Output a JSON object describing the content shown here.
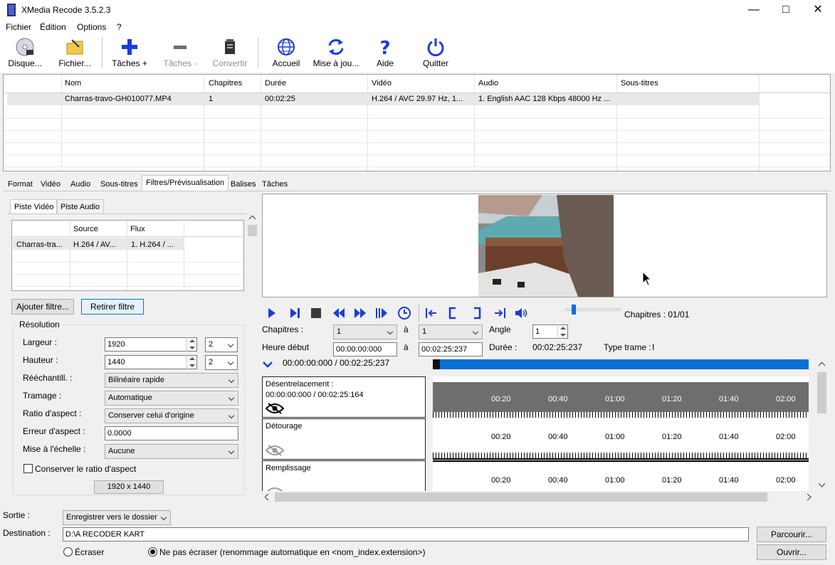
{
  "window": {
    "title": "XMedia Recode 3.5.2.3"
  },
  "menu": [
    "Fichier",
    "Édition",
    "Options",
    "?"
  ],
  "toolbar": {
    "disc": "Disque...",
    "file": "Fichier...",
    "add_task": "Tâches +",
    "remove_task": "Tâches -",
    "convert": "Convertir",
    "home": "Accueil",
    "update": "Mise à jou...",
    "help": "Aide",
    "quit": "Quitter"
  },
  "filelist": {
    "headers": [
      "Nom",
      "Chapitres",
      "Durée",
      "Vidéo",
      "Audio",
      "Sous-titres"
    ],
    "rows": [
      {
        "name": "Charras-travo-GH010077.MP4",
        "chapters": "1",
        "duration": "00:02:25",
        "video": "H.264 / AVC  29.97 Hz, 1...",
        "audio": "1. English AAC  128 Kbps 48000 Hz ...",
        "subtitles": ""
      }
    ]
  },
  "tabs": [
    "Format",
    "Vidéo",
    "Audio",
    "Sous-titres",
    "Filtres/Prévisualisation",
    "Balises",
    "Tâches"
  ],
  "left": {
    "subtabs": [
      "Piste Vidéo",
      "Piste Audio"
    ],
    "grid": {
      "headers": [
        "",
        "Source",
        "Flux"
      ],
      "row": [
        "Charras-tra...",
        "H.264 / AV...",
        "1. H.264 / ..."
      ]
    },
    "add_filter": "Ajouter filtre...",
    "remove_filter": "Retirer filtre",
    "resolution_group": "Résolution",
    "width_label": "Largeur :",
    "width_value": "1920",
    "width_mult": "2",
    "height_label": "Hauteur :",
    "height_value": "1440",
    "height_mult": "2",
    "resample_label": "Rééchantill. :",
    "resample_value": "Bilinéaire rapide",
    "dither_label": "Tramage :",
    "dither_value": "Automatique",
    "aspect_label": "Ratio d'aspect :",
    "aspect_value": "Conserver celui d'origine",
    "aspect_error_label": "Erreur d'aspect :",
    "aspect_error_value": "0.0000",
    "scale_label": "Mise à l'échelle :",
    "scale_value": "Aucune",
    "keep_ratio_label": "Conserver le ratio d'aspect",
    "resolution_display": "1920 x 1440"
  },
  "player": {
    "chapters_count": "Chapitres : 01/01",
    "chapters_label": "Chapitres :",
    "chapter_from": "1",
    "to_label": "à",
    "chapter_to": "1",
    "angle_label": "Angle",
    "angle_value": "1",
    "start_label": "Heure début",
    "start_value": "00:00:00:000",
    "end_value": "00:02:25:237",
    "duration_label": "Durée :",
    "duration_value": "00:02:25:237",
    "frame_type_label": "Type trame :",
    "frame_type_value": "I",
    "position": "00:00:00:000 / 00:02:25:237",
    "progress": 0.0
  },
  "timeline": {
    "tracks": [
      {
        "name": "Désentrelacement :",
        "time": "00:00:00:000 / 00:02:25:164"
      },
      {
        "name": "Détourage",
        "time": ""
      },
      {
        "name": "Remplissage",
        "time": ""
      }
    ],
    "ruler": [
      "00:20",
      "00:40",
      "01:00",
      "01:20",
      "01:40",
      "02:00"
    ]
  },
  "bottom": {
    "output_label": "Sortie :",
    "output_value": "Enregistrer vers le dossier",
    "dest_label": "Destination :",
    "dest_value": "D:\\A RECODER KART",
    "browse": "Parcourir...",
    "open": "Ouvrir...",
    "overwrite": "Écraser",
    "no_overwrite": "Ne pas écraser (renommage automatique en <nom_index.extension>)"
  },
  "colors": {
    "accent": "#0a6fd6",
    "icon_blue": "#1a3cd8",
    "timeline_gray": "#6e6e6e"
  }
}
